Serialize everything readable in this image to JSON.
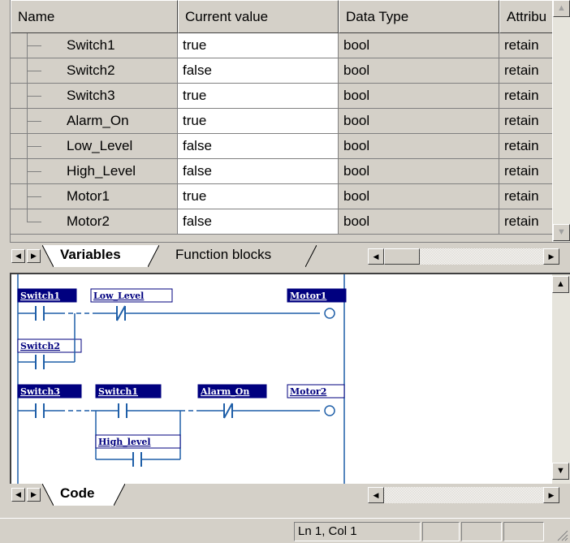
{
  "grid": {
    "headers": {
      "name": "Name",
      "value": "Current value",
      "type": "Data Type",
      "attr": "Attribu"
    },
    "rows": [
      {
        "name": "Switch1",
        "value": "true",
        "type": "bool",
        "attr": "retain"
      },
      {
        "name": "Switch2",
        "value": "false",
        "type": "bool",
        "attr": "retain"
      },
      {
        "name": "Switch3",
        "value": "true",
        "type": "bool",
        "attr": "retain"
      },
      {
        "name": "Alarm_On",
        "value": "true",
        "type": "bool",
        "attr": "retain"
      },
      {
        "name": "Low_Level",
        "value": "false",
        "type": "bool",
        "attr": "retain"
      },
      {
        "name": "High_Level",
        "value": "false",
        "type": "bool",
        "attr": "retain"
      },
      {
        "name": "Motor1",
        "value": "true",
        "type": "bool",
        "attr": "retain"
      },
      {
        "name": "Motor2",
        "value": "false",
        "type": "bool",
        "attr": "retain"
      }
    ]
  },
  "tabs_top": {
    "variables": "Variables",
    "function_blocks": "Function blocks"
  },
  "ladder": {
    "rung1": {
      "c1": "Switch1",
      "c2": "Switch2",
      "c3": "Low_Level",
      "coil": "Motor1"
    },
    "rung2": {
      "c1": "Switch3",
      "c2": "Switch1",
      "c3": "High_level",
      "c4": "Alarm_On",
      "coil": "Motor2"
    }
  },
  "tabs_bottom": {
    "code": "Code"
  },
  "status": {
    "position": "Ln 1, Col 1"
  },
  "colors": {
    "label_bg": "#00007f",
    "wire": "#1f5fa8",
    "panel": "#d4d0c8"
  },
  "icons": [
    "scroll-up-arrow-icon",
    "scroll-down-arrow-icon",
    "scroll-left-arrow-icon",
    "scroll-right-arrow-icon",
    "size-grip-icon"
  ]
}
